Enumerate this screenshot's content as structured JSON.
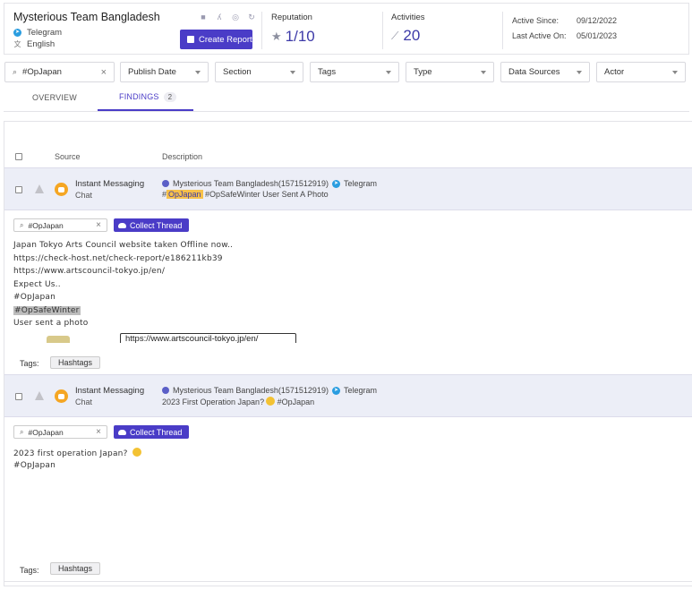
{
  "header": {
    "team_name": "Mysterious Team Bangladesh",
    "platform": "Telegram",
    "language": "English",
    "create_report_label": "Create Report",
    "reputation_label": "Reputation",
    "reputation_value": "1/10",
    "activities_label": "Activities",
    "activities_value": "20",
    "active_since_label": "Active Since:",
    "active_since_value": "09/12/2022",
    "last_active_label": "Last Active On:",
    "last_active_value": "05/01/2023",
    "tool_icons": [
      "briefcase-icon",
      "translate-icon",
      "fingerprint-icon",
      "refresh-icon"
    ]
  },
  "filters": {
    "search_value": "#OpJapan",
    "publish_date": "Publish Date",
    "section": "Section",
    "tags": "Tags",
    "type": "Type",
    "data_sources": "Data Sources",
    "actor": "Actor"
  },
  "tabs": {
    "overview": "OVERVIEW",
    "findings": "FINDINGS",
    "findings_count": "2"
  },
  "table": {
    "col_source": "Source",
    "col_description": "Description"
  },
  "findings": [
    {
      "source_title": "Instant Messaging",
      "source_sub": "Chat",
      "author": "Mysterious Team Bangladesh(1571512919)",
      "platform": "Telegram",
      "desc_hash_prefix": "#",
      "desc_highlight": "OpJapan",
      "desc_rest": " #OpSafeWinter User Sent A Photo",
      "search_value": "#OpJapan",
      "collect_label": "Collect Thread",
      "body_lines": [
        "Japan Tokyo Arts Council website taken Offline now..",
        "https://check-host.net/check-report/e186211kb39",
        "https://www.artscouncil-tokyo.jp/en/",
        "Expect Us..",
        "#OpJapan"
      ],
      "body_highlight_line": "#OpSafeWinter",
      "body_last_line": "User sent a photo",
      "photo_url_text": "https://www.artscouncil-tokyo.jp/en/",
      "tags_label": "Tags:",
      "tag": "Hashtags"
    },
    {
      "source_title": "Instant Messaging",
      "source_sub": "Chat",
      "author": "Mysterious Team Bangladesh(1571512919)",
      "platform": "Telegram",
      "desc_text": "2023 First Operation Japan?",
      "desc_tail": "#OpJapan",
      "search_value": "#OpJapan",
      "collect_label": "Collect Thread",
      "body_line1": "2023 first operation Japan?",
      "body_line2": "#OpJapan",
      "tags_label": "Tags:",
      "tag": "Hashtags"
    }
  ],
  "colors": {
    "accent": "#4a3cc7",
    "highlight": "#f7c14a",
    "telegram": "#2a9de0",
    "source_icon": "#f5a623"
  }
}
